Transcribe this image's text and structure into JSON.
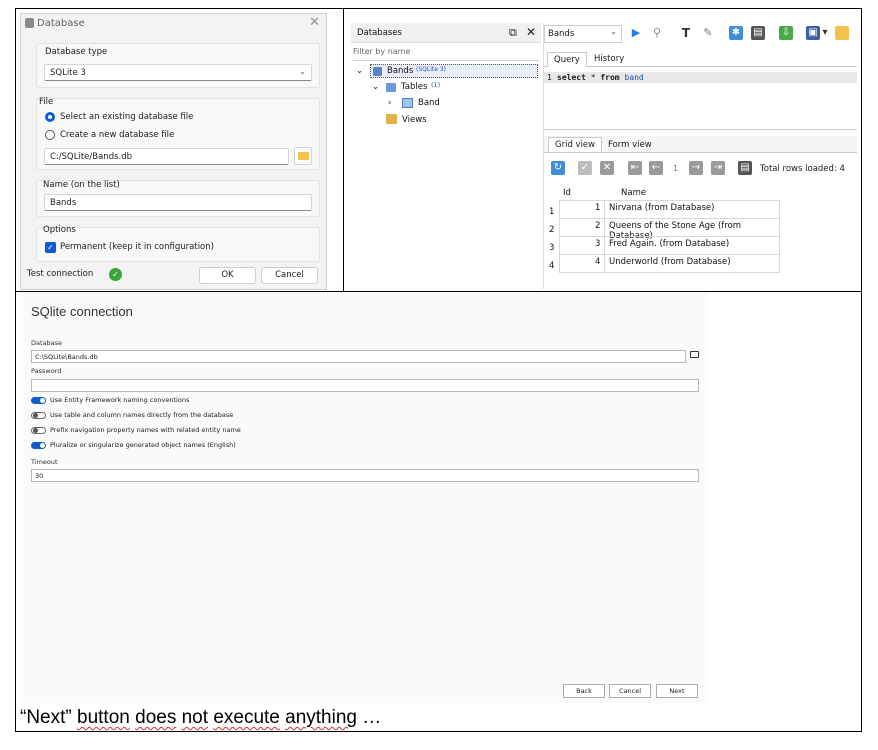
{
  "dialog": {
    "title": "Database",
    "close": "✕",
    "db_type_label": "Database type",
    "db_type_value": "SQLite 3",
    "file_label": "File",
    "radio_existing": "Select an existing database file",
    "radio_new": "Create a new database file",
    "file_path": "C:/SQLite/Bands.db",
    "name_label": "Name (on the list)",
    "name_value": "Bands",
    "options_label": "Options",
    "permanent_label": "Permanent (keep it in configuration)",
    "test_connection": "Test connection",
    "ok": "OK",
    "cancel": "Cancel"
  },
  "databases_panel": {
    "title": "Databases",
    "filter_placeholder": "Filter by name",
    "tree": {
      "db_name": "Bands",
      "db_badge": "(SQLite 3)",
      "tables_label": "Tables",
      "tables_count": "(1)",
      "table_band": "Band",
      "views_label": "Views"
    }
  },
  "editor": {
    "db_select": "Bands",
    "tabs": [
      "Query",
      "History"
    ],
    "line_number": "1",
    "sql_kw1": "select",
    "sql_mid": " * ",
    "sql_kw2": "from",
    "sql_table": " band",
    "result_tabs": [
      "Grid view",
      "Form view"
    ],
    "page_number": "1",
    "total_rows": "Total rows loaded: 4",
    "grid": {
      "headers": [
        "Id",
        "Name"
      ],
      "rows": [
        {
          "rownum": "1",
          "id": "1",
          "name": "Nirvana (from Database)"
        },
        {
          "rownum": "2",
          "id": "2",
          "name": "Queens of the Stone Age (from Database)"
        },
        {
          "rownum": "3",
          "id": "3",
          "name": "Fred Again. (from Database)"
        },
        {
          "rownum": "4",
          "id": "4",
          "name": "Underworld (from Database)"
        }
      ]
    }
  },
  "sqlite": {
    "title": "SQlite connection",
    "database_label": "Database",
    "database_value": "C:\\SQLite\\Bands.db",
    "password_label": "Password",
    "password_value": "",
    "toggles": [
      {
        "label": "Use Entity Framework naming conventions",
        "on": true
      },
      {
        "label": "Use table and column names directly from the database",
        "on": false
      },
      {
        "label": "Prefix navigation property names with related entity name",
        "on": false
      },
      {
        "label": "Pluralize or singularize generated object names (English)",
        "on": true
      }
    ],
    "timeout_label": "Timeout",
    "timeout_value": "30",
    "back": "Back",
    "cancel": "Cancel",
    "next": "Next"
  },
  "caption": {
    "quote_open": "“",
    "next": "Next",
    "quote_close": "” ",
    "w1": "button",
    "w2": "does",
    "w3": "not",
    "w4": "execute",
    "w5": "anything",
    "ellipsis": " …"
  },
  "colors": {
    "accent": "#0b5cd7",
    "keyword": "#000000",
    "table_name": "#1f4fbf"
  }
}
